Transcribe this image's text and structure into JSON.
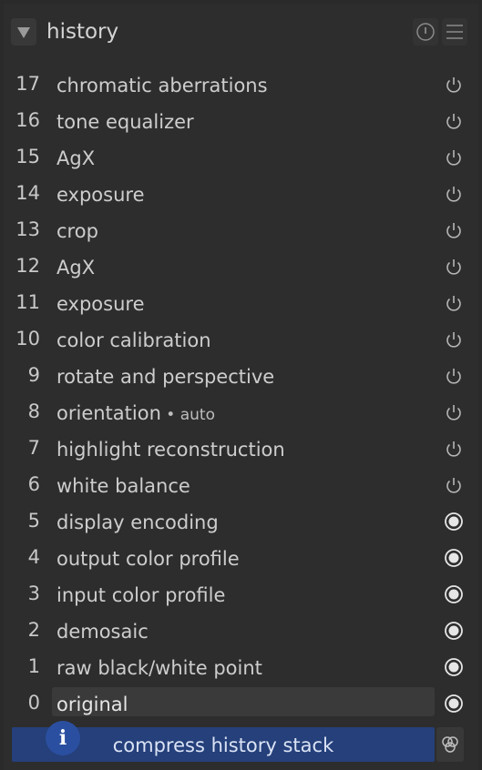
{
  "header": {
    "title": "history",
    "collapse_icon": "triangle-down-icon",
    "reset_icon": "reset-icon",
    "presets_icon": "hamburger-menu-icon"
  },
  "history": {
    "items": [
      {
        "num": "17",
        "label": "chromatic aberrations",
        "sub": "",
        "state": "power"
      },
      {
        "num": "16",
        "label": "tone equalizer",
        "sub": "",
        "state": "power"
      },
      {
        "num": "15",
        "label": "AgX",
        "sub": "",
        "state": "power"
      },
      {
        "num": "14",
        "label": "exposure",
        "sub": "",
        "state": "power"
      },
      {
        "num": "13",
        "label": "crop",
        "sub": "",
        "state": "power"
      },
      {
        "num": "12",
        "label": "AgX",
        "sub": "",
        "state": "power"
      },
      {
        "num": "11",
        "label": "exposure",
        "sub": "",
        "state": "power"
      },
      {
        "num": "10",
        "label": "color calibration",
        "sub": "",
        "state": "power"
      },
      {
        "num": "9",
        "label": "rotate and perspective",
        "sub": "",
        "state": "power"
      },
      {
        "num": "8",
        "label": "orientation",
        "sub": " • auto",
        "state": "power"
      },
      {
        "num": "7",
        "label": "highlight reconstruction",
        "sub": "",
        "state": "power"
      },
      {
        "num": "6",
        "label": "white balance",
        "sub": "",
        "state": "power"
      },
      {
        "num": "5",
        "label": "display encoding",
        "sub": "",
        "state": "always-on"
      },
      {
        "num": "4",
        "label": "output color profile",
        "sub": "",
        "state": "always-on"
      },
      {
        "num": "3",
        "label": "input color profile",
        "sub": "",
        "state": "always-on"
      },
      {
        "num": "2",
        "label": "demosaic",
        "sub": "",
        "state": "always-on"
      },
      {
        "num": "1",
        "label": "raw black/white point",
        "sub": "",
        "state": "always-on"
      },
      {
        "num": "0",
        "label": "original",
        "sub": "",
        "state": "always-on",
        "selected": true
      }
    ]
  },
  "footer": {
    "compress_label": "compress history stack",
    "info_badge": "i",
    "styles_icon": "create-style-icon"
  },
  "colors": {
    "background": "#2d2d2d",
    "accent_button": "#25407a",
    "selected_row": "#3a3a3a",
    "text": "#cdcdcd"
  }
}
